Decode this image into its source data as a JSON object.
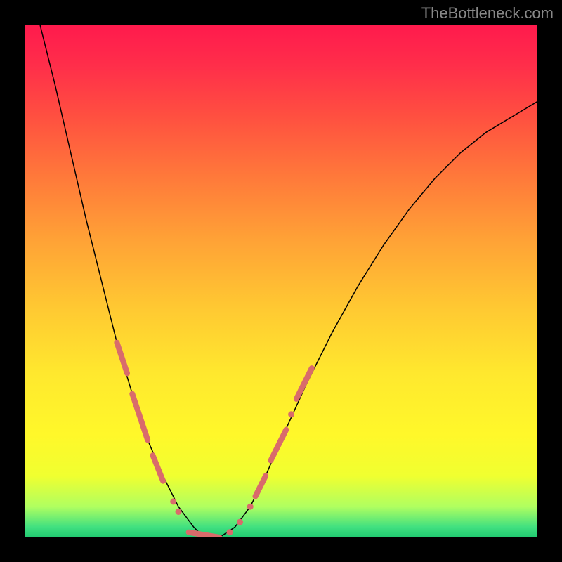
{
  "watermark": "TheBottleneck.com",
  "chart_data": {
    "type": "line",
    "title": "",
    "xlabel": "",
    "ylabel": "",
    "xlim": [
      0,
      100
    ],
    "ylim": [
      0,
      100
    ],
    "series": [
      {
        "name": "bottleneck-curve",
        "x": [
          0,
          3,
          6,
          9,
          12,
          15,
          18,
          21,
          24,
          27,
          30,
          33,
          35,
          38,
          41,
          44,
          47,
          50,
          55,
          60,
          65,
          70,
          75,
          80,
          85,
          90,
          95,
          100
        ],
        "y": [
          110,
          100,
          88,
          75,
          62,
          50,
          38,
          28,
          19,
          12,
          6,
          2,
          0,
          0,
          2,
          6,
          12,
          19,
          30,
          40,
          49,
          57,
          64,
          70,
          75,
          79,
          82,
          85
        ]
      }
    ],
    "markers": {
      "name": "highlighted-points",
      "color": "#d96b6b",
      "segments": [
        {
          "type": "line",
          "x1": 18,
          "y1": 38,
          "x2": 20,
          "y2": 32
        },
        {
          "type": "line",
          "x1": 21,
          "y1": 28,
          "x2": 24,
          "y2": 19
        },
        {
          "type": "line",
          "x1": 25,
          "y1": 16,
          "x2": 27,
          "y2": 11
        },
        {
          "type": "point",
          "x": 29,
          "y": 7
        },
        {
          "type": "point",
          "x": 30,
          "y": 5
        },
        {
          "type": "line",
          "x1": 32,
          "y1": 1,
          "x2": 38,
          "y2": 0
        },
        {
          "type": "point",
          "x": 40,
          "y": 1
        },
        {
          "type": "point",
          "x": 42,
          "y": 3
        },
        {
          "type": "point",
          "x": 44,
          "y": 6
        },
        {
          "type": "line",
          "x1": 45,
          "y1": 8,
          "x2": 47,
          "y2": 12
        },
        {
          "type": "line",
          "x1": 48,
          "y1": 15,
          "x2": 51,
          "y2": 21
        },
        {
          "type": "point",
          "x": 52,
          "y": 24
        },
        {
          "type": "line",
          "x1": 53,
          "y1": 27,
          "x2": 56,
          "y2": 33
        }
      ]
    },
    "colors": {
      "gradient_top": "#ff1a4d",
      "gradient_mid": "#ffe82e",
      "gradient_bottom": "#20c970",
      "curve": "#000000",
      "marker": "#d96b6b",
      "background": "#000000"
    }
  }
}
